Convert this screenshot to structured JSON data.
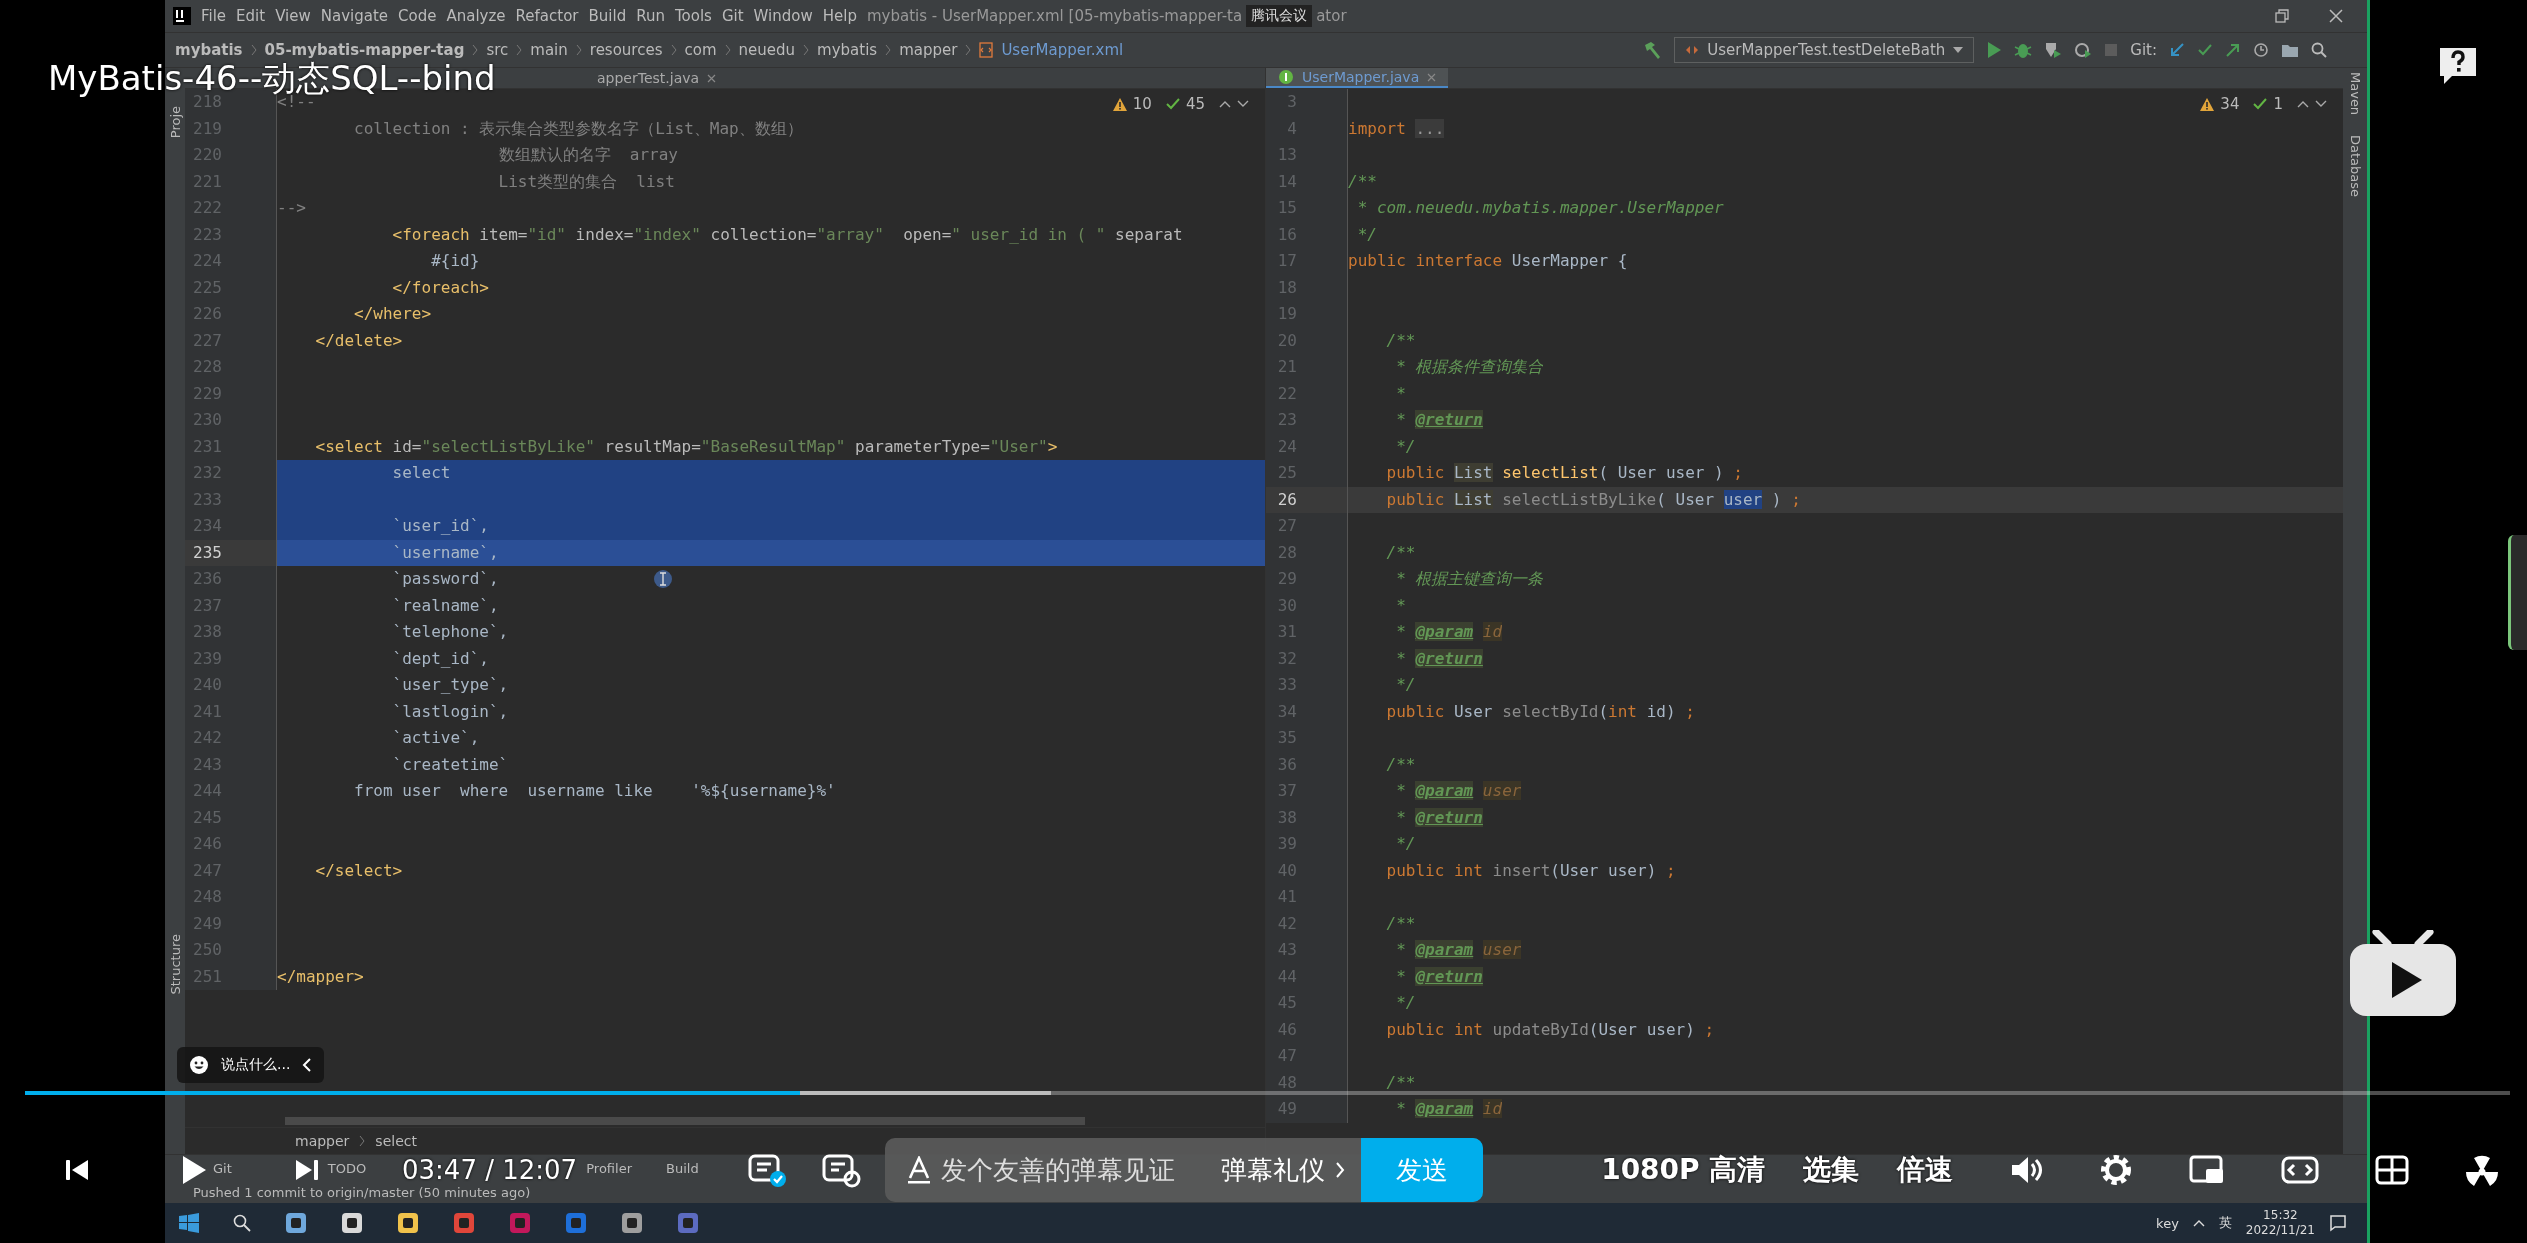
{
  "video_title": "MyBatis-46--动态SQL--bind",
  "ide": {
    "menu": [
      "File",
      "Edit",
      "View",
      "Navigate",
      "Code",
      "Analyze",
      "Refactor",
      "Build",
      "Run",
      "Tools",
      "Git",
      "Window",
      "Help"
    ],
    "window_title": "mybatis - UserMapper.xml [05-mybatis-mapper-ta",
    "meeting_label": "腾讯会议",
    "window_title_end": "ator",
    "breadcrumbs": [
      "mybatis",
      "05-mybatis-mapper-tag",
      "src",
      "main",
      "resources",
      "com",
      "neuedu",
      "mybatis",
      "mapper",
      "UserMapper.xml"
    ],
    "run_config": "UserMapperTest.testDeleteBath",
    "git_label": "Git:",
    "left_strip": [
      "Proje",
      "Structure"
    ],
    "right_strip": [
      "Maven",
      "Database"
    ],
    "left_editor": {
      "tabs": [
        {
          "label": "apperTest.java",
          "selected": false
        }
      ],
      "warnings": "10",
      "checks": "45",
      "lines": [
        {
          "number": "218",
          "segments": [
            {
              "text": "<!--",
              "kind": "comment"
            }
          ],
          "selected": false,
          "current": false
        },
        {
          "number": "219",
          "segments": [
            {
              "text": "        collection : 表示集合类型参数名字（List、Map、数组）",
              "kind": "comment"
            }
          ],
          "selected": false,
          "current": false
        },
        {
          "number": "220",
          "segments": [
            {
              "text": "                       数组默认的名字  array",
              "kind": "comment"
            }
          ],
          "selected": false,
          "current": false
        },
        {
          "number": "221",
          "segments": [
            {
              "text": "                       List类型的集合  list",
              "kind": "comment"
            }
          ],
          "selected": false,
          "current": false
        },
        {
          "number": "222",
          "segments": [
            {
              "text": "-->",
              "kind": "comment"
            }
          ],
          "selected": false,
          "current": false
        },
        {
          "number": "223",
          "segments": [
            {
              "text": "            <foreach",
              "kind": "tag"
            },
            {
              "text": " item=",
              "kind": "attr"
            },
            {
              "text": "\"id\"",
              "kind": "str"
            },
            {
              "text": " index=",
              "kind": "attr"
            },
            {
              "text": "\"index\"",
              "kind": "str"
            },
            {
              "text": " collection=",
              "kind": "attr"
            },
            {
              "text": "\"array\"",
              "kind": "str"
            },
            {
              "text": "  open=",
              "kind": "attr"
            },
            {
              "text": "\" user_id in ( \"",
              "kind": "str"
            },
            {
              "text": " separat",
              "kind": "attr"
            }
          ],
          "selected": false,
          "current": false
        },
        {
          "number": "224",
          "segments": [
            {
              "text": "                #{id}",
              "kind": "plain"
            }
          ],
          "selected": false,
          "current": false
        },
        {
          "number": "225",
          "segments": [
            {
              "text": "            </foreach>",
              "kind": "tag"
            }
          ],
          "selected": false,
          "current": false
        },
        {
          "number": "226",
          "segments": [
            {
              "text": "        </where>",
              "kind": "tag"
            }
          ],
          "selected": false,
          "current": false
        },
        {
          "number": "227",
          "segments": [
            {
              "text": "    </delete>",
              "kind": "tag"
            }
          ],
          "selected": false,
          "current": false
        },
        {
          "number": "228"
        },
        {
          "number": "229"
        },
        {
          "number": "230"
        },
        {
          "number": "231",
          "segments": [
            {
              "text": "    <select",
              "kind": "tag"
            },
            {
              "text": " id=",
              "kind": "attr"
            },
            {
              "text": "\"selectListByLike\"",
              "kind": "str"
            },
            {
              "text": " resultMap=",
              "kind": "attr"
            },
            {
              "text": "\"BaseResultMap\"",
              "kind": "str"
            },
            {
              "text": " parameterType=",
              "kind": "attr"
            },
            {
              "text": "\"User\"",
              "kind": "str"
            },
            {
              "text": ">",
              "kind": "tag"
            }
          ],
          "selected": false,
          "current": false
        },
        {
          "number": "232",
          "segments": [
            {
              "text": "            select",
              "kind": "plain"
            }
          ],
          "selected": true,
          "current": false
        },
        {
          "number": "233",
          "selected": true,
          "current": false
        },
        {
          "number": "234",
          "segments": [
            {
              "text": "            `user_id`,",
              "kind": "plain"
            }
          ],
          "selected": true,
          "current": false
        },
        {
          "number": "235",
          "segments": [
            {
              "text": "            `username`,",
              "kind": "plain"
            }
          ],
          "selected": true,
          "current": true
        },
        {
          "number": "236",
          "segments": [
            {
              "text": "            `password`,",
              "kind": "plain"
            }
          ],
          "selected": false,
          "current": false
        },
        {
          "number": "237",
          "segments": [
            {
              "text": "            `realname`,",
              "kind": "plain"
            }
          ],
          "selected": false,
          "current": false
        },
        {
          "number": "238",
          "segments": [
            {
              "text": "            `telephone`,",
              "kind": "plain"
            }
          ],
          "selected": false,
          "current": false
        },
        {
          "number": "239",
          "segments": [
            {
              "text": "            `dept_id`,",
              "kind": "plain"
            }
          ],
          "selected": false,
          "current": false
        },
        {
          "number": "240",
          "segments": [
            {
              "text": "            `user_type`,",
              "kind": "plain"
            }
          ],
          "selected": false,
          "current": false
        },
        {
          "number": "241",
          "segments": [
            {
              "text": "            `lastlogin`,",
              "kind": "plain"
            }
          ],
          "selected": false,
          "current": false
        },
        {
          "number": "242",
          "segments": [
            {
              "text": "            `active`,",
              "kind": "plain"
            }
          ],
          "selected": false,
          "current": false
        },
        {
          "number": "243",
          "segments": [
            {
              "text": "            `createtime`",
              "kind": "plain"
            }
          ],
          "selected": false,
          "current": false
        },
        {
          "number": "244",
          "segments": [
            {
              "text": "        from user  where  username like    '%${username}%'",
              "kind": "plain"
            }
          ],
          "selected": false,
          "current": false
        },
        {
          "number": "245"
        },
        {
          "number": "246"
        },
        {
          "number": "247",
          "segments": [
            {
              "text": "    </select>",
              "kind": "tag"
            }
          ],
          "selected": false,
          "current": false
        },
        {
          "number": "248"
        },
        {
          "number": "249"
        },
        {
          "number": "250"
        },
        {
          "number": "251",
          "segments": [
            {
              "text": "</mapper>",
              "kind": "tag"
            }
          ],
          "selected": false,
          "current": false
        }
      ],
      "breadcrumb": [
        "mapper",
        "select"
      ]
    },
    "right_editor": {
      "tabs": [
        {
          "label": "UserMapper.java",
          "selected": true
        }
      ],
      "warnings": "34",
      "checks": "1",
      "lines": [
        {
          "number": "3"
        },
        {
          "number": "4",
          "segments": [
            {
              "text": "import",
              "kind": "kw"
            },
            {
              "text": "...",
              "kind": "fold"
            }
          ],
          "current": false
        },
        {
          "number": "13"
        },
        {
          "number": "14",
          "segments": [
            {
              "text": "/**",
              "kind": "doc"
            }
          ],
          "current": false
        },
        {
          "number": "15",
          "segments": [
            {
              "text": " * com.neuedu.mybatis.mapper.UserMapper",
              "kind": "doc"
            }
          ],
          "current": false
        },
        {
          "number": "16",
          "segments": [
            {
              "text": " */",
              "kind": "doc"
            }
          ],
          "current": false
        },
        {
          "number": "17",
          "segments": [
            {
              "text": "public interface",
              "kind": "kw"
            },
            {
              "text": " UserMapper {",
              "kind": "plain"
            }
          ],
          "current": false
        },
        {
          "number": "18"
        },
        {
          "number": "19"
        },
        {
          "number": "20",
          "segments": [
            {
              "text": "    /**",
              "kind": "doc"
            }
          ],
          "current": false
        },
        {
          "number": "21",
          "segments": [
            {
              "text": "     * 根据条件查询集合",
              "kind": "doc"
            }
          ],
          "current": false
        },
        {
          "number": "22",
          "segments": [
            {
              "text": "     *",
              "kind": "doc"
            }
          ],
          "current": false
        },
        {
          "number": "23",
          "segments": [
            {
              "text": "     * ",
              "kind": "doc"
            },
            {
              "text": "@return",
              "kind": "doctag"
            }
          ],
          "current": false
        },
        {
          "number": "24",
          "segments": [
            {
              "text": "     */",
              "kind": "doc"
            }
          ],
          "current": false
        },
        {
          "number": "25",
          "segments": [
            {
              "text": "    public ",
              "kind": "kw"
            },
            {
              "text": "List",
              "kind": "typehl"
            },
            {
              "text": "selectList",
              "kind": "method"
            },
            {
              "text": "( User user ) ",
              "kind": "plain"
            },
            {
              "text": ";",
              "kind": "kw"
            }
          ],
          "current": false
        },
        {
          "number": "26",
          "segments": [
            {
              "text": "    public ",
              "kind": "kw"
            },
            {
              "text": "List",
              "kind": "typehl"
            },
            {
              "text": "selectListByLike",
              "kind": "unused"
            },
            {
              "text": "( User ",
              "kind": "plain"
            },
            {
              "text": "user",
              "kind": "wordsel"
            },
            {
              "text": " ) ",
              "kind": "plain"
            },
            {
              "text": ";",
              "kind": "kw"
            }
          ],
          "current": true
        },
        {
          "number": "27"
        },
        {
          "number": "28",
          "segments": [
            {
              "text": "    /**",
              "kind": "doc"
            }
          ],
          "current": false
        },
        {
          "number": "29",
          "segments": [
            {
              "text": "     * 根据主键查询一条",
              "kind": "doc"
            }
          ],
          "current": false
        },
        {
          "number": "30",
          "segments": [
            {
              "text": "     *",
              "kind": "doc"
            }
          ],
          "current": false
        },
        {
          "number": "31",
          "segments": [
            {
              "text": "     * ",
              "kind": "doc"
            },
            {
              "text": "@param",
              "kind": "doctag"
            },
            {
              "text": "id",
              "kind": "param"
            }
          ],
          "current": false
        },
        {
          "number": "32",
          "segments": [
            {
              "text": "     * ",
              "kind": "doc"
            },
            {
              "text": "@return",
              "kind": "doctag"
            }
          ],
          "current": false
        },
        {
          "number": "33",
          "segments": [
            {
              "text": "     */",
              "kind": "doc"
            }
          ],
          "current": false
        },
        {
          "number": "34",
          "segments": [
            {
              "text": "    public",
              "kind": "kw"
            },
            {
              "text": " User ",
              "kind": "plain"
            },
            {
              "text": "selectById",
              "kind": "unused"
            },
            {
              "text": "(",
              "kind": "plain"
            },
            {
              "text": "int",
              "kind": "kw"
            },
            {
              "text": " id) ",
              "kind": "plain"
            },
            {
              "text": ";",
              "kind": "kw"
            }
          ],
          "current": false
        },
        {
          "number": "35"
        },
        {
          "number": "36",
          "segments": [
            {
              "text": "    /**",
              "kind": "doc"
            }
          ],
          "current": false
        },
        {
          "number": "37",
          "segments": [
            {
              "text": "     * ",
              "kind": "doc"
            },
            {
              "text": "@param",
              "kind": "doctag"
            },
            {
              "text": "user",
              "kind": "param"
            }
          ],
          "current": false
        },
        {
          "number": "38",
          "segments": [
            {
              "text": "     * ",
              "kind": "doc"
            },
            {
              "text": "@return",
              "kind": "doctag"
            }
          ],
          "current": false
        },
        {
          "number": "39",
          "segments": [
            {
              "text": "     */",
              "kind": "doc"
            }
          ],
          "current": false
        },
        {
          "number": "40",
          "segments": [
            {
              "text": "    public int",
              "kind": "kw"
            },
            {
              "text": " insert",
              "kind": "unused"
            },
            {
              "text": "(User user) ",
              "kind": "plain"
            },
            {
              "text": ";",
              "kind": "kw"
            }
          ],
          "current": false
        },
        {
          "number": "41"
        },
        {
          "number": "42",
          "segments": [
            {
              "text": "    /**",
              "kind": "doc"
            }
          ],
          "current": false
        },
        {
          "number": "43",
          "segments": [
            {
              "text": "     * ",
              "kind": "doc"
            },
            {
              "text": "@param",
              "kind": "doctag"
            },
            {
              "text": "user",
              "kind": "param"
            }
          ],
          "current": false
        },
        {
          "number": "44",
          "segments": [
            {
              "text": "     * ",
              "kind": "doc"
            },
            {
              "text": "@return",
              "kind": "doctag"
            }
          ],
          "current": false
        },
        {
          "number": "45",
          "segments": [
            {
              "text": "     */",
              "kind": "doc"
            }
          ],
          "current": false
        },
        {
          "number": "46",
          "segments": [
            {
              "text": "    public int",
              "kind": "kw"
            },
            {
              "text": " updateById",
              "kind": "unused"
            },
            {
              "text": "(User user) ",
              "kind": "plain"
            },
            {
              "text": ";",
              "kind": "kw"
            }
          ],
          "current": false
        },
        {
          "number": "47"
        },
        {
          "number": "48",
          "segments": [
            {
              "text": "    /**",
              "kind": "doc"
            }
          ],
          "current": false
        },
        {
          "number": "49",
          "segments": [
            {
              "text": "     * ",
              "kind": "doc"
            },
            {
              "text": "@param",
              "kind": "doctag"
            },
            {
              "text": "id",
              "kind": "param"
            }
          ],
          "current": false
        }
      ]
    },
    "tool_windows": [
      "Git",
      "TODO",
      "Profiler",
      "Build"
    ],
    "status": "Pushed 1 commit to origin/master (50 minutes ago)",
    "taskbar": {
      "tray_text": "key",
      "ime": "英",
      "time": "15:32",
      "date": "2022/11/21"
    }
  },
  "player": {
    "chat_bubble": "说点什么...",
    "progress": {
      "level": 0.312,
      "buffer": {
        "level": 0.413
      }
    },
    "time": "03:47 / 12:07",
    "danmaku_placeholder": "发个友善的弹幕见证",
    "etiquette": "弹幕礼仪",
    "send": "发送",
    "quality": "1080P 高清",
    "episodes": "选集",
    "speed": "倍速"
  }
}
